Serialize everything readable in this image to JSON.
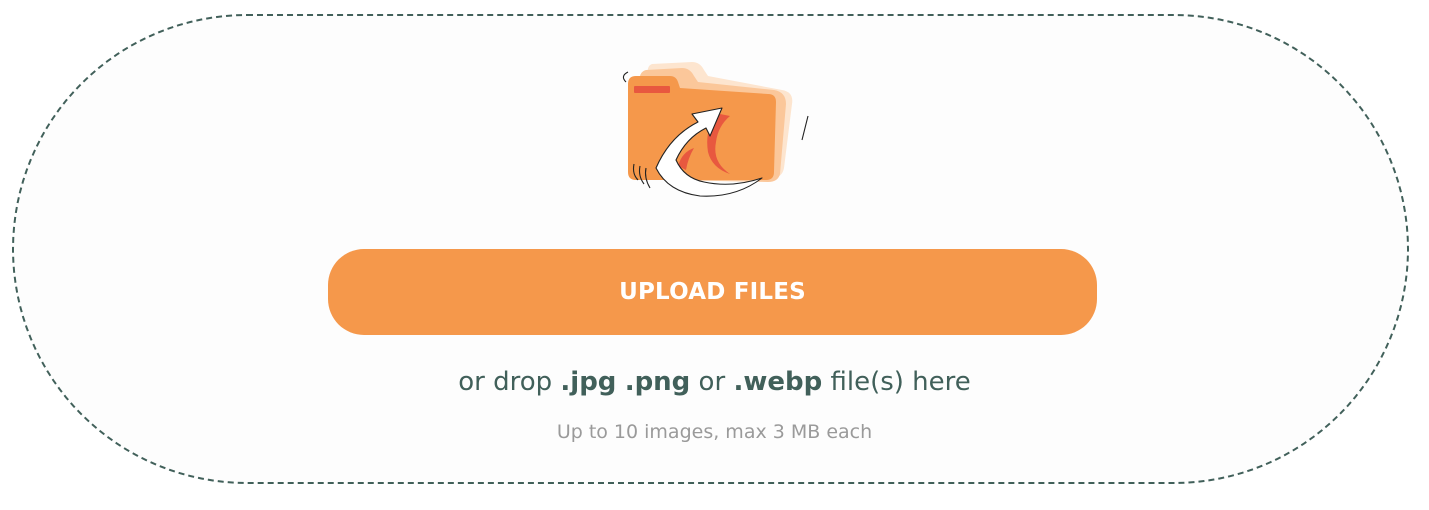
{
  "upload_button": {
    "label": "UPLOAD FILES"
  },
  "drop_hint": {
    "prefix": "or drop ",
    "ext_jpg": ".jpg",
    "sep_space": " ",
    "ext_png": ".png",
    "middle": " or ",
    "ext_webp": ".webp",
    "suffix": " file(s) here"
  },
  "limits": {
    "text": "Up to 10 images, max 3 MB each"
  },
  "illustration": {
    "icon": "folder-upload-icon"
  },
  "colors": {
    "accent_orange": "#f5984b",
    "folder_orange": "#f5984b",
    "folder_red_tab": "#e8583f",
    "dashed_border": "#41605a",
    "text_dark": "#41605a",
    "text_muted": "#9a9a9a"
  }
}
